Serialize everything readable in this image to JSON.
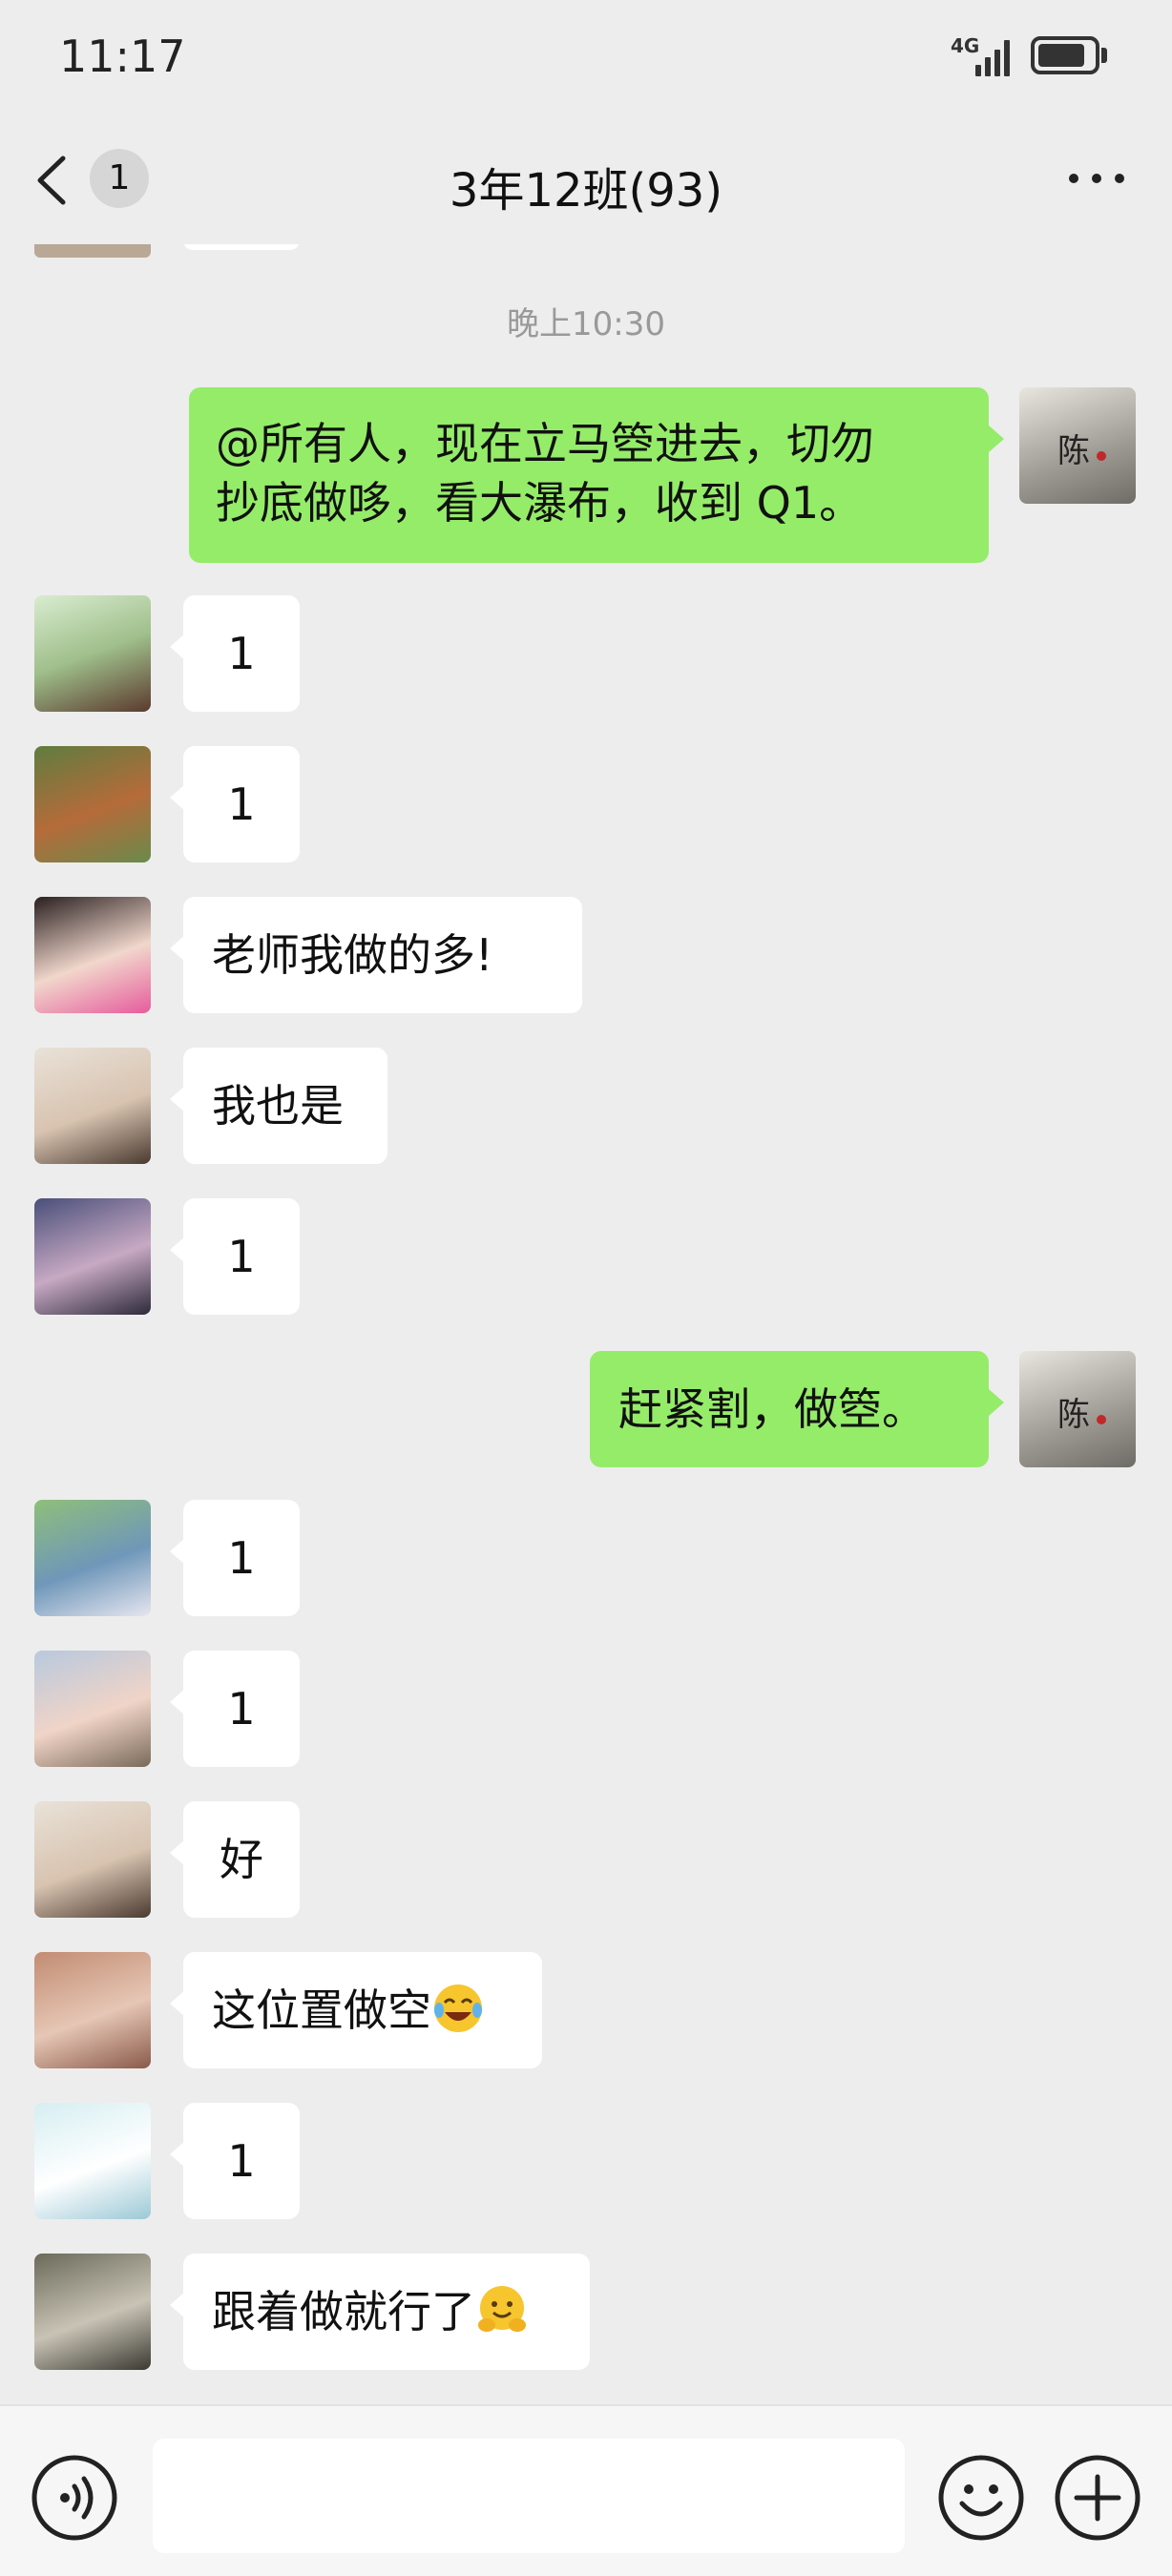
{
  "status_bar": {
    "time": "11:17",
    "network": "4G",
    "battery_level": 0.85,
    "signal_bars": 4
  },
  "header": {
    "unread_badge": "1",
    "title": "3年12班(93)"
  },
  "chat": {
    "time_divider": "晚上10:30",
    "messages": [
      {
        "side": "right",
        "text": "@所有人，现在立马箜进去，切勿\n抄底做哆，看大瀑布，收到 Q1。",
        "avatar": "ink-painting-chen-avatar"
      },
      {
        "side": "left",
        "text": "1",
        "avatar": "girl-back-avatar"
      },
      {
        "side": "left",
        "text": "1",
        "avatar": "redhead-woman-avatar"
      },
      {
        "side": "left",
        "text": "老师我做的多!",
        "avatar": "smiling-girl-avatar"
      },
      {
        "side": "left",
        "text": "我也是",
        "avatar": "glasses-girl-avatar"
      },
      {
        "side": "left",
        "text": "1",
        "avatar": "lying-girl-avatar"
      },
      {
        "side": "right",
        "text": "赶紧割，做箜。",
        "avatar": "ink-painting-chen-avatar"
      },
      {
        "side": "left",
        "text": "1",
        "avatar": "couple-avatar"
      },
      {
        "side": "left",
        "text": "1",
        "avatar": "flower-avatar"
      },
      {
        "side": "left",
        "text": "好",
        "avatar": "glasses-girl-avatar"
      },
      {
        "side": "left",
        "text": "这位置做空",
        "emoji": "tears-of-joy-emoji",
        "avatar": "woman-portrait-avatar"
      },
      {
        "side": "left",
        "text": "1",
        "avatar": "white-dress-hat-avatar"
      },
      {
        "side": "left",
        "text": "跟着做就行了",
        "emoji": "hugging-face-emoji",
        "avatar": "street-woman-avatar"
      }
    ]
  },
  "input_bar": {
    "text_value": ""
  },
  "colors": {
    "background": "#ededed",
    "own_bubble": "#95ec69",
    "other_bubble": "#ffffff",
    "input_bar": "#f6f6f6"
  }
}
